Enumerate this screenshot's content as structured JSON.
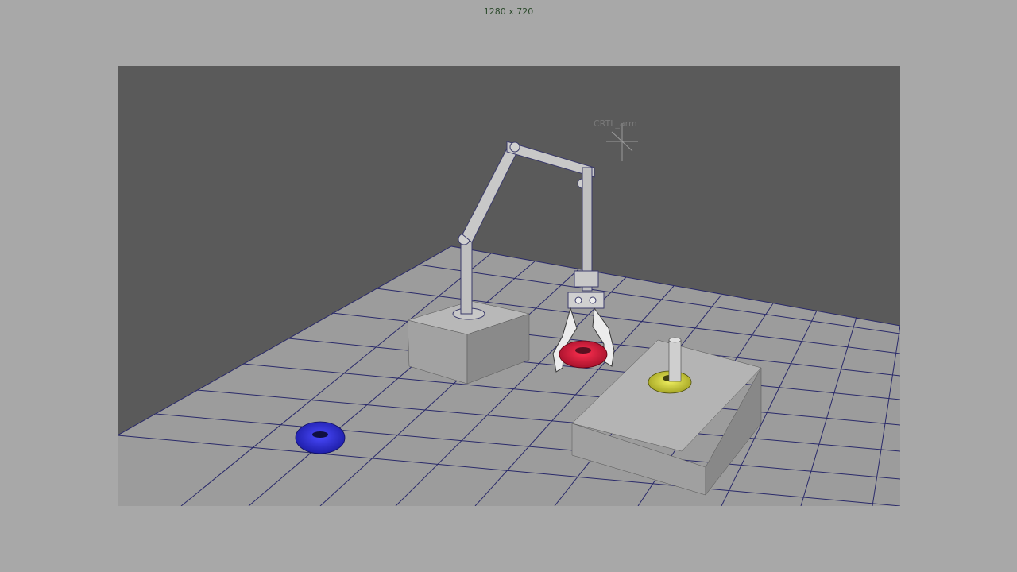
{
  "viewport": {
    "resolution_label": "1280 x 720",
    "control_label": "CRTL_arm"
  },
  "scene": {
    "objects": [
      {
        "name": "robot-arm",
        "color": "#b0b0b0"
      },
      {
        "name": "gripper",
        "color": "#e8e8e8"
      },
      {
        "name": "red-torus",
        "color": "#d0203a"
      },
      {
        "name": "blue-torus",
        "color": "#2a2ad0"
      },
      {
        "name": "yellow-torus",
        "color": "#d8e040"
      },
      {
        "name": "peg",
        "color": "#c8c8c8"
      }
    ],
    "grid_color": "#2a2a6a",
    "floor_color": "#9a9a9a",
    "background_color": "#5a5a5a"
  }
}
